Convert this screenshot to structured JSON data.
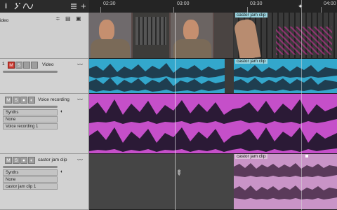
{
  "ruler": {
    "ticks": [
      "02:30",
      "03:00",
      "03:30",
      "04:00"
    ]
  },
  "tracks": [
    {
      "name": "video",
      "label": "ideo"
    },
    {
      "number": "1",
      "name": "Video",
      "buttons": [
        "M",
        "S"
      ]
    },
    {
      "name": "Voice recording",
      "buttons": [
        "M",
        "S"
      ],
      "dropdowns": [
        "Synths",
        "None",
        "Voice recording 1"
      ]
    },
    {
      "name": "castor jam clip",
      "buttons": [
        "M",
        "S"
      ],
      "dropdowns": [
        "Synths",
        "None",
        "castor jam clip 1"
      ]
    }
  ],
  "clips": {
    "video_clip": "castor jam clip",
    "audio1_clip": "castor jam clip",
    "audio3_clip": "castor jam clip"
  },
  "colors": {
    "blue": "#33a7cc",
    "magenta": "#c54fc9",
    "pink": "#c994c7",
    "waveform": "#1f3e50"
  }
}
